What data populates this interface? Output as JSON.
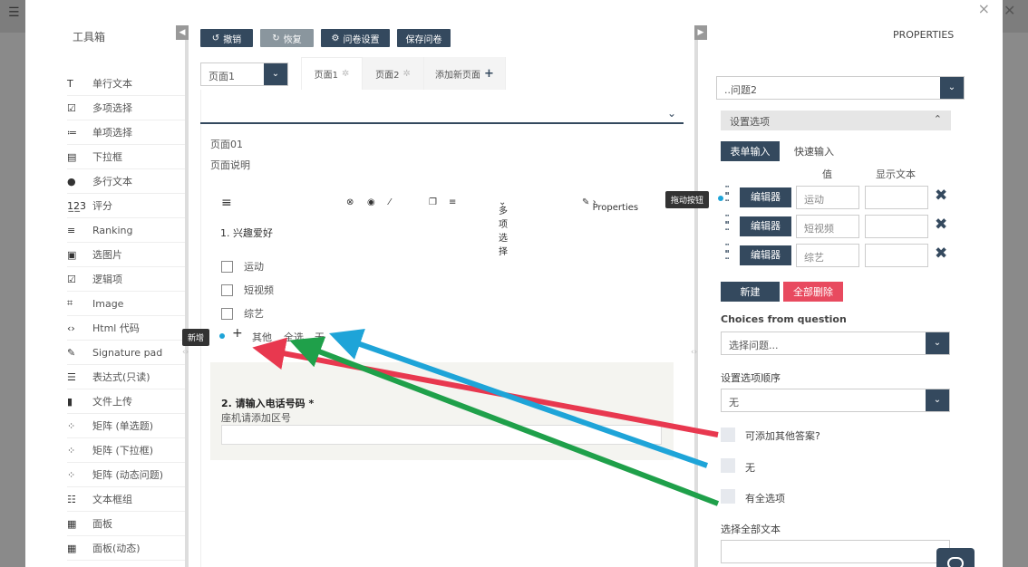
{
  "toolbox": {
    "title": "工具箱",
    "items": [
      {
        "icon": "T",
        "label": "单行文本"
      },
      {
        "icon": "☑",
        "label": "多项选择"
      },
      {
        "icon": "≔",
        "label": "单项选择"
      },
      {
        "icon": "▤",
        "label": "下拉框"
      },
      {
        "icon": "●",
        "label": "多行文本"
      },
      {
        "icon": "1̲2̲3",
        "label": "评分"
      },
      {
        "icon": "≡",
        "label": "Ranking"
      },
      {
        "icon": "▣",
        "label": "选图片"
      },
      {
        "icon": "☑",
        "label": "逻辑项"
      },
      {
        "icon": "⌗",
        "label": "Image"
      },
      {
        "icon": "‹›",
        "label": "Html 代码"
      },
      {
        "icon": "✎",
        "label": "Signature pad"
      },
      {
        "icon": "☰",
        "label": "表达式(只读)"
      },
      {
        "icon": "▮",
        "label": "文件上传"
      },
      {
        "icon": "⁘",
        "label": "矩阵 (单选题)"
      },
      {
        "icon": "⁘",
        "label": "矩阵 (下拉框)"
      },
      {
        "icon": "⁘",
        "label": "矩阵 (动态问题)"
      },
      {
        "icon": "☷",
        "label": "文本框组"
      },
      {
        "icon": "▦",
        "label": "面板"
      },
      {
        "icon": "▦",
        "label": "面板(动态)"
      }
    ]
  },
  "toolbar": {
    "undo": "撤销",
    "redo": "恢复",
    "survey_settings": "问卷设置",
    "save": "保存问卷"
  },
  "pages": {
    "selected": "页面1",
    "tabs": [
      "页面1",
      "页面2"
    ],
    "add_page": "添加新页面"
  },
  "page": {
    "title": "页面01",
    "description": "页面说明"
  },
  "question_toolbar": {
    "type_label": "多项选择",
    "properties_label": "Properties"
  },
  "q1": {
    "title": "1. 兴趣爱好",
    "choices": [
      "运动",
      "短视频",
      "综艺"
    ],
    "add_tooltip": "新增",
    "add_symbol": "+",
    "other": "其他",
    "select_all": "全选",
    "none": "无"
  },
  "q2": {
    "title": "2. 请输入电话号码 *",
    "description": "座机请添加区号"
  },
  "properties": {
    "title": "PROPERTIES",
    "question_select": "..问题2",
    "group_title": "设置选项",
    "tab_form": "表单输入",
    "tab_quick": "快速输入",
    "col_value": "值",
    "col_text": "显示文本",
    "drag_tooltip": "拖动按钮",
    "editor_label": "编辑器",
    "rows": [
      "运动",
      "短视频",
      "综艺"
    ],
    "new_button": "新建",
    "delete_all_button": "全部删除",
    "choices_from_label": "Choices from question",
    "choices_from_placeholder": "选择问题...",
    "order_label": "设置选项顺序",
    "order_value": "无",
    "has_other": "可添加其他答案?",
    "has_none": "无",
    "has_select_all": "有全选项",
    "select_all_text_label": "选择全部文本"
  },
  "colors": {
    "primary": "#34495e",
    "danger": "#e84a5f",
    "arrow_red": "#e8384f",
    "arrow_blue": "#1ea4d8",
    "arrow_green": "#1fa04a"
  }
}
